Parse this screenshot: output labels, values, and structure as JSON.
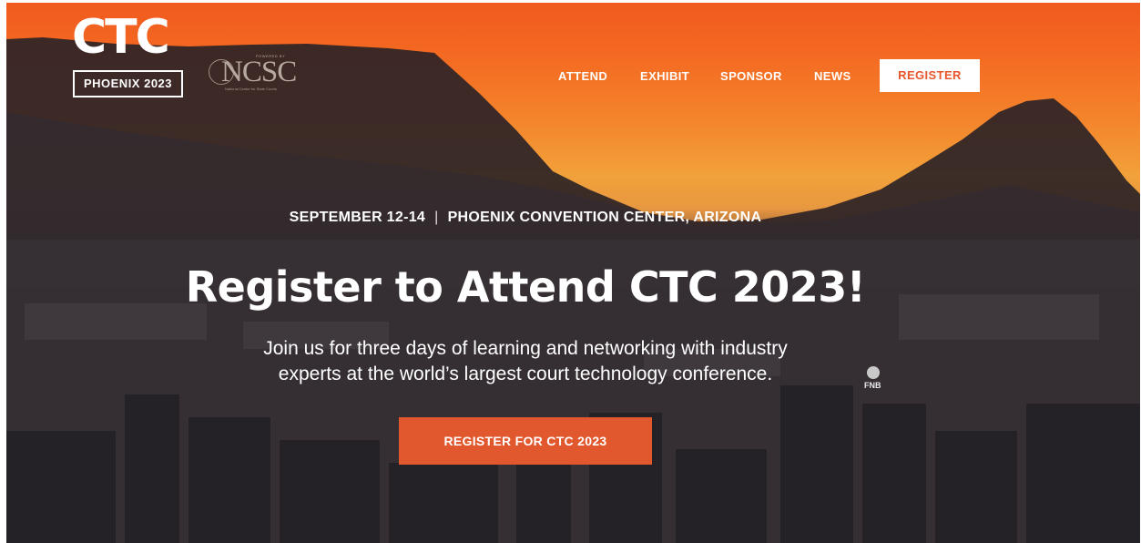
{
  "brand": {
    "logo_text": "CTC",
    "edition": "PHOENIX 2023",
    "partner_powered": "POWERED BY",
    "partner_name": "NCSC",
    "partner_subtitle": "National Center for State Courts"
  },
  "nav": {
    "items": [
      "ATTEND",
      "EXHIBIT",
      "SPONSOR",
      "NEWS"
    ],
    "register_label": "REGISTER"
  },
  "hero": {
    "dates": "SEPTEMBER 12-14",
    "separator": "|",
    "venue": "PHOENIX CONVENTION CENTER, ARIZONA",
    "headline": "Register to Attend CTC 2023!",
    "lede_line1": "Join us for three days of learning and networking with industry",
    "lede_line2": "experts at the world’s largest court technology conference.",
    "cta_label": "REGISTER FOR CTC 2023",
    "building_sign": "FNB"
  },
  "colors": {
    "accent": "#e2582e",
    "sky_top": "#f05a1e",
    "sky_glow": "#f2a13a",
    "city_dark": "#2c2a30"
  }
}
